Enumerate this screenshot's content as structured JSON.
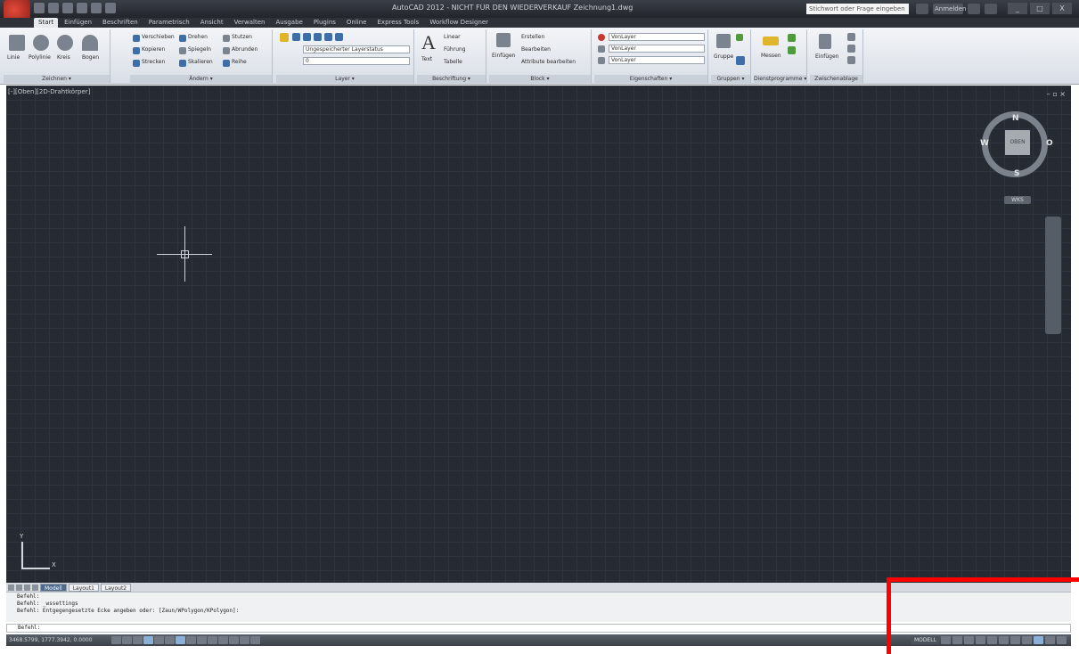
{
  "title_bar": {
    "window_title": "AutoCAD 2012 - NICHT FÜR DEN WIEDERVERKAUF   Zeichnung1.dwg",
    "search_placeholder": "Stichwort oder Frage eingeben",
    "user_label": "Anmelden",
    "window_controls": [
      "_",
      "□",
      "X"
    ]
  },
  "tabs": [
    "Start",
    "Einfügen",
    "Beschriften",
    "Parametrisch",
    "Ansicht",
    "Verwalten",
    "Ausgabe",
    "Plugins",
    "Online",
    "Express Tools",
    "Workflow Designer"
  ],
  "active_tab": "Start",
  "ribbon": {
    "panels": [
      {
        "title": "Zeichnen ▾",
        "tools": [
          "Linie",
          "Polylinie",
          "Kreis",
          "Bogen"
        ]
      },
      {
        "title": "Ändern ▾",
        "tools": [
          "Verschieben",
          "Drehen",
          "Stutzen",
          "Kopieren",
          "Spiegeln",
          "Abrunden",
          "Strecken",
          "Skalieren",
          "Reihe"
        ]
      },
      {
        "title": "Layer ▾",
        "tools": [
          "Ungespeicherter Layerstatus",
          "0"
        ]
      },
      {
        "title": "Beschriftung ▾",
        "tools": [
          "Text",
          "Linear",
          "Führung",
          "Tabelle"
        ]
      },
      {
        "title": "Block ▾",
        "tools": [
          "Einfügen",
          "Erstellen",
          "Bearbeiten",
          "Attribute bearbeiten"
        ]
      },
      {
        "title": "Eigenschaften ▾",
        "tools": [
          "VonLayer",
          "VonLayer",
          "VonLayer"
        ]
      },
      {
        "title": "Gruppen ▾",
        "tools": [
          "Gruppe"
        ]
      },
      {
        "title": "Dienstprogramme ▾",
        "tools": [
          "Messen"
        ]
      },
      {
        "title": "Zwischenablage",
        "tools": [
          "Einfügen"
        ]
      }
    ]
  },
  "viewport": {
    "label": "[-][Oben][2D-Drahtkörper]",
    "controls": "– ▫ ×",
    "viewcube": {
      "face": "OBEN",
      "north": "N",
      "south": "S",
      "west": "W",
      "east": "O",
      "wcs": "WKS"
    },
    "ucs": {
      "x": "X",
      "y": "Y"
    }
  },
  "layout_tabs": [
    "Modell",
    "Layout1",
    "Layout2"
  ],
  "active_layout": "Modell",
  "command_history": [
    "Befehl:",
    "Befehl: _wssettings",
    "Befehl: Entgegengesetzte Ecke angeben oder: [Zaun/WPolygon/KPolygon]:"
  ],
  "command_prompt": "Befehl:",
  "status_bar": {
    "coordinates": "3468.5799, 1777.3942, 0.0000",
    "model_label": "MODELL",
    "drafting_toggles": 14,
    "right_toggles": 11
  },
  "colors": {
    "canvas": "#262a33",
    "highlight": "#ff0000"
  }
}
